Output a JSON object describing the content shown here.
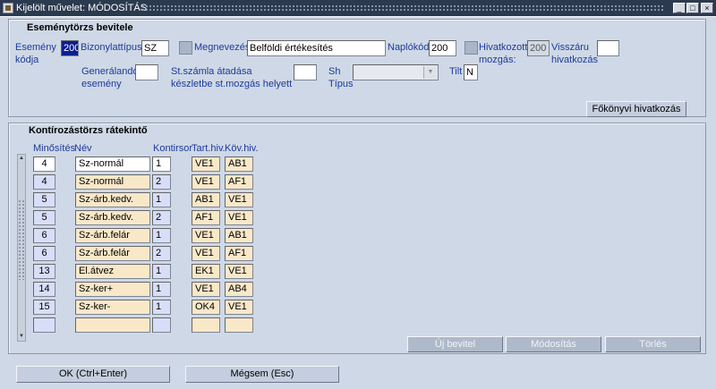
{
  "window": {
    "title": "Kijelölt művelet: MÓDOSÍTÁS",
    "controls": [
      "_",
      "□",
      "×"
    ]
  },
  "header_panel": {
    "title": "Eseménytörzs bevitele",
    "esemeny_kodja_label_1": "Esemény",
    "esemeny_kodja_label_2": "kódja",
    "esemeny_kodja_value": "200",
    "bizonylattipus_label": "Bizonylattípus",
    "bizonylattipus_value": "SZ",
    "megnevezes_label": "Megnevezés",
    "megnevezes_value": "Belföldi értékesítés",
    "naplokod_label": "Naplókód",
    "naplokod_value": "200",
    "hivatkozott_mozgas_label_1": "Hivatkozott",
    "hivatkozott_mozgas_label_2": "mozgás:",
    "hivatkozott_mozgas_value": "200",
    "visszaru_label_1": "Visszáru",
    "visszaru_label_2": "hivatkozás",
    "visszaru_value": "",
    "generalando_label_1": "Generálandó",
    "generalando_label_2": "esemény",
    "generalando_value": "",
    "st_szamla_label_1": "St.számla átadása",
    "st_szamla_label_2": "készletbe st.mozgás helyett",
    "st_szamla_value": "",
    "sh_tipus_label_1": "Sh",
    "sh_tipus_label_2": "Típus",
    "sh_tipus_value": "",
    "tilt_label": "Tilt",
    "tilt_value": "N",
    "fokonyvi_button": "Főkönyvi hivatkozás"
  },
  "list_panel": {
    "title": "Kontírozástörzs rátekintő",
    "columns": [
      "Minősítés",
      "Név",
      "Kontirsor",
      "Tart.hiv.",
      "Köv.hiv."
    ],
    "rows": [
      {
        "minosites": "4",
        "nev": "Sz-normál",
        "kontirsor": "1",
        "tart": "VE1",
        "kov": "AB1"
      },
      {
        "minosites": "4",
        "nev": "Sz-normál",
        "kontirsor": "2",
        "tart": "VE1",
        "kov": "AF1"
      },
      {
        "minosites": "5",
        "nev": "Sz-árb.kedv.",
        "kontirsor": "1",
        "tart": "AB1",
        "kov": "VE1"
      },
      {
        "minosites": "5",
        "nev": "Sz-árb.kedv.",
        "kontirsor": "2",
        "tart": "AF1",
        "kov": "VE1"
      },
      {
        "minosites": "6",
        "nev": "Sz-árb.felár",
        "kontirsor": "1",
        "tart": "VE1",
        "kov": "AB1"
      },
      {
        "minosites": "6",
        "nev": "Sz-árb.felár",
        "kontirsor": "2",
        "tart": "VE1",
        "kov": "AF1"
      },
      {
        "minosites": "13",
        "nev": "El.átvez",
        "kontirsor": "1",
        "tart": "EK1",
        "kov": "VE1"
      },
      {
        "minosites": "14",
        "nev": "Sz-ker+",
        "kontirsor": "1",
        "tart": "VE1",
        "kov": "AB4"
      },
      {
        "minosites": "15",
        "nev": "Sz-ker-",
        "kontirsor": "1",
        "tart": "OK4",
        "kov": "VE1"
      },
      {
        "minosites": "",
        "nev": "",
        "kontirsor": "",
        "tart": "",
        "kov": ""
      }
    ],
    "buttons": {
      "new": "Új bevitel",
      "modify": "Módosítás",
      "delete": "Törlés"
    }
  },
  "footer": {
    "ok": "OK (Ctrl+Enter)",
    "cancel": "Mégsem (Esc)"
  },
  "colors": {
    "background": "#cfd8e6",
    "titlebar": "#2b3a4e",
    "label_blue": "#1c3a9c",
    "selected_field": "#0b1f8f",
    "cell_white": "#ffffff",
    "cell_peach": "#f9e8c8",
    "cell_lavender": "#d8def8"
  }
}
